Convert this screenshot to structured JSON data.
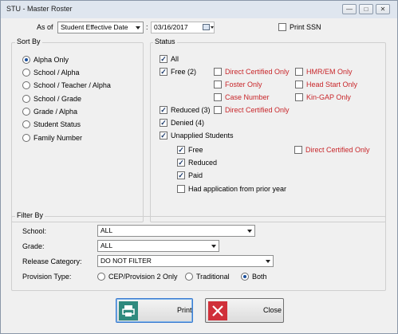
{
  "window": {
    "title": "STU - Master Roster"
  },
  "titlebar_buttons": [
    "minimize-icon",
    "restore-icon",
    "close-icon"
  ],
  "as_of": {
    "label": "As of",
    "mode_value": "Student Effective Date",
    "colon": ":",
    "date_value": "03/16/2017"
  },
  "print_ssn": {
    "label": "Print SSN",
    "checked": false
  },
  "sort_by": {
    "title": "Sort By",
    "options": [
      {
        "label": "Alpha Only",
        "selected": true
      },
      {
        "label": "School / Alpha",
        "selected": false
      },
      {
        "label": "School / Teacher / Alpha",
        "selected": false
      },
      {
        "label": "School / Grade",
        "selected": false
      },
      {
        "label": "Grade / Alpha",
        "selected": false
      },
      {
        "label": "Student Status",
        "selected": false
      },
      {
        "label": "Family Number",
        "selected": false
      }
    ]
  },
  "status": {
    "title": "Status",
    "all": {
      "label": "All",
      "checked": true
    },
    "free": {
      "label": "Free (2)",
      "checked": true
    },
    "free_sub_col1": [
      {
        "label": "Direct Certified Only",
        "checked": false
      },
      {
        "label": "Foster Only",
        "checked": false
      },
      {
        "label": "Case Number",
        "checked": false
      }
    ],
    "free_sub_col2": [
      {
        "label": "HMR/EM Only",
        "checked": false
      },
      {
        "label": "Head Start Only",
        "checked": false
      },
      {
        "label": "Kin-GAP Only",
        "checked": false
      }
    ],
    "reduced": {
      "label": "Reduced (3)",
      "checked": true
    },
    "reduced_direct": {
      "label": "Direct Certified Only",
      "checked": false
    },
    "denied": {
      "label": "Denied (4)",
      "checked": true
    },
    "unapplied": {
      "label": "Unapplied Students",
      "checked": true
    },
    "unapplied_sub": [
      {
        "label": "Free",
        "checked": true
      },
      {
        "label": "Reduced",
        "checked": true
      },
      {
        "label": "Paid",
        "checked": true
      },
      {
        "label": "Had application from prior year",
        "checked": false
      }
    ],
    "unapplied_direct": {
      "label": "Direct Certified Only",
      "checked": false
    }
  },
  "filter_by": {
    "title": "Filter By",
    "school": {
      "label": "School:",
      "value": "ALL"
    },
    "grade": {
      "label": "Grade:",
      "value": "ALL"
    },
    "release_category": {
      "label": "Release Category:",
      "value": "DO NOT FILTER"
    },
    "provision_type": {
      "label": "Provision Type:",
      "options": [
        {
          "label": "CEP/Provision 2 Only",
          "selected": false
        },
        {
          "label": "Traditional",
          "selected": false
        },
        {
          "label": "Both",
          "selected": true
        }
      ]
    }
  },
  "buttons": {
    "print": "Print",
    "close": "Close"
  },
  "colors": {
    "red_label": "#c8262a",
    "print_icon": "#2f8a7e",
    "close_icon": "#d0303a",
    "selection_highlight": "#7eb4ea"
  }
}
